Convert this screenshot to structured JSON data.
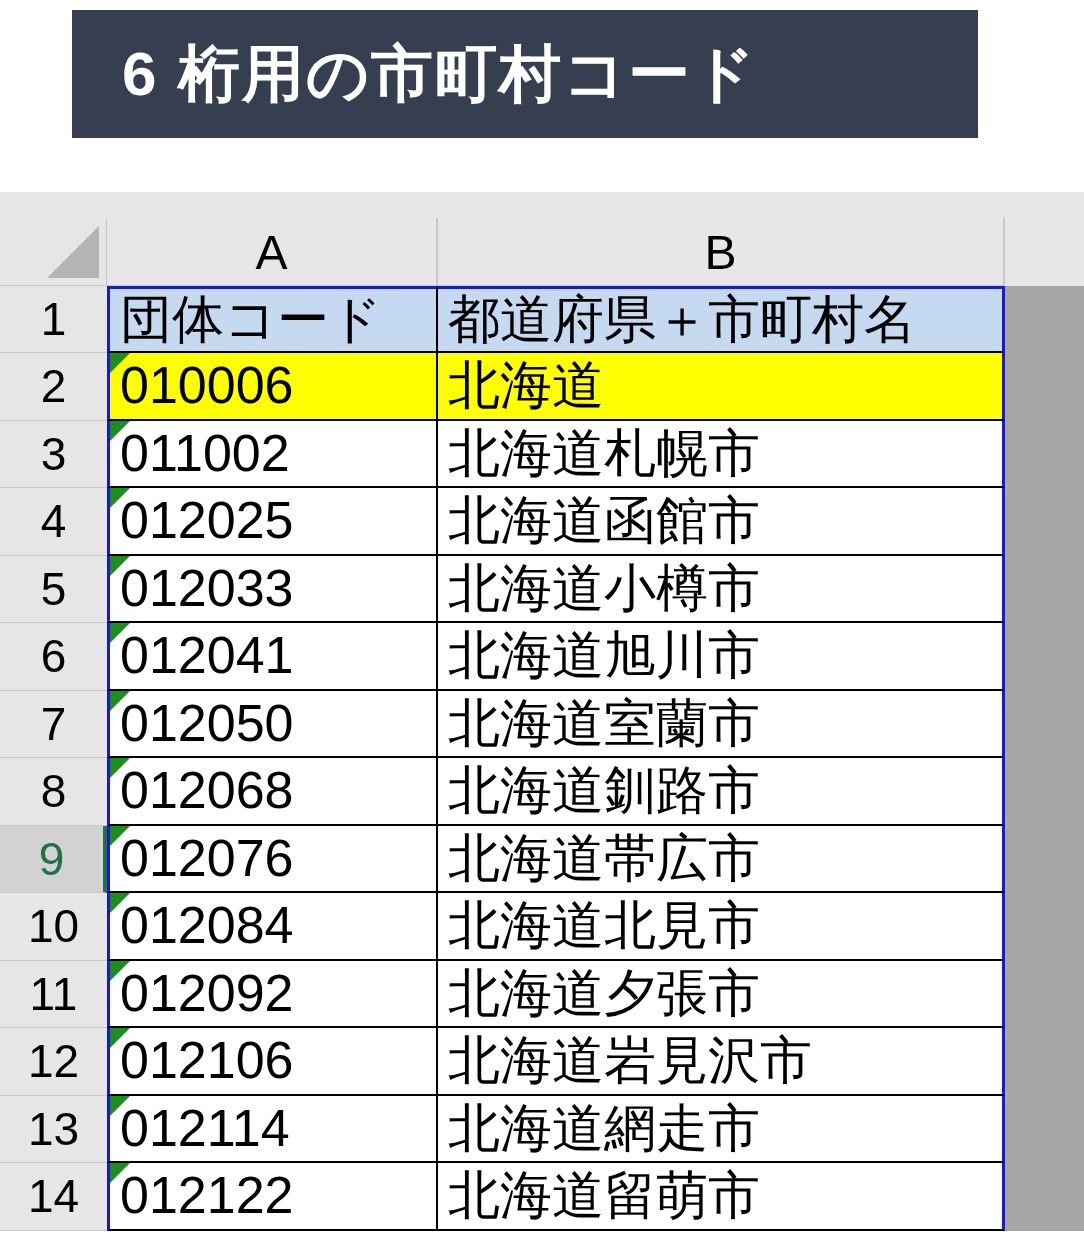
{
  "title": "6 桁用の市町村コード",
  "columns": [
    {
      "label": "A",
      "selected": false
    },
    {
      "label": "B",
      "selected": false
    }
  ],
  "rows": [
    {
      "number": "1",
      "selected": false,
      "kind": "header",
      "code": "団体コード",
      "name": "都道府県＋市町村名",
      "error_indicator": false
    },
    {
      "number": "2",
      "selected": false,
      "kind": "highlight",
      "code": "010006",
      "name": "北海道",
      "error_indicator": true
    },
    {
      "number": "3",
      "selected": false,
      "kind": "data",
      "code": "011002",
      "name": "北海道札幌市",
      "error_indicator": true
    },
    {
      "number": "4",
      "selected": false,
      "kind": "data",
      "code": "012025",
      "name": "北海道函館市",
      "error_indicator": true
    },
    {
      "number": "5",
      "selected": false,
      "kind": "data",
      "code": "012033",
      "name": "北海道小樽市",
      "error_indicator": true
    },
    {
      "number": "6",
      "selected": false,
      "kind": "data",
      "code": "012041",
      "name": "北海道旭川市",
      "error_indicator": true
    },
    {
      "number": "7",
      "selected": false,
      "kind": "data",
      "code": "012050",
      "name": "北海道室蘭市",
      "error_indicator": true
    },
    {
      "number": "8",
      "selected": false,
      "kind": "data",
      "code": "012068",
      "name": "北海道釧路市",
      "error_indicator": true
    },
    {
      "number": "9",
      "selected": true,
      "kind": "data",
      "code": "012076",
      "name": "北海道帯広市",
      "error_indicator": true
    },
    {
      "number": "10",
      "selected": false,
      "kind": "data",
      "code": "012084",
      "name": "北海道北見市",
      "error_indicator": true
    },
    {
      "number": "11",
      "selected": false,
      "kind": "data",
      "code": "012092",
      "name": "北海道夕張市",
      "error_indicator": true
    },
    {
      "number": "12",
      "selected": false,
      "kind": "data",
      "code": "012106",
      "name": "北海道岩見沢市",
      "error_indicator": true
    },
    {
      "number": "13",
      "selected": false,
      "kind": "data",
      "code": "012114",
      "name": "北海道網走市",
      "error_indicator": true
    },
    {
      "number": "14",
      "selected": false,
      "kind": "data",
      "code": "012122",
      "name": "北海道留萌市",
      "error_indicator": true
    }
  ]
}
